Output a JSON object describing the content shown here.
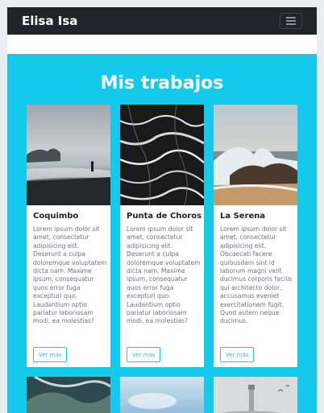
{
  "navbar": {
    "brand": "Elisa Isa",
    "toggle_icon": "hamburger-icon"
  },
  "section": {
    "title": "Mis trabajos",
    "background": "#15c9ea"
  },
  "cards": [
    {
      "title": "Coquimbo",
      "text": "Lorem ipsum dolor sit amet, consectetur adipisicing elit. Deserunt a culpa doloremque voluptatem dicta nam. Maxime ipsum, consequatur quos error fuga excepturi quo. Laudantium optio pariatur laboriosam modi, ea molestias?",
      "button": "Ver más"
    },
    {
      "title": "Punta de Choros",
      "text": "Lorem ipsum dolor sit amet, consectetur adipisicing elit. Deserunt a culpa doloremque voluptatem dicta nam. Maxime ipsum, consequatur quos error fuga excepturi quo. Laudantium optio pariatur laboriosam modi, ea molestias?",
      "button": "Ver más"
    },
    {
      "title": "La Serena",
      "text": "Lorem ipsum dolor sit amet, consectetur adipisicing elit. Obcaecati facere quibusdam sint id laborum magni velit ducimus corporis facilis qui architecto dolor, accusamus eveniet exercitationem fugit. Quod autem neque ducimus.",
      "button": "Ver más"
    }
  ]
}
